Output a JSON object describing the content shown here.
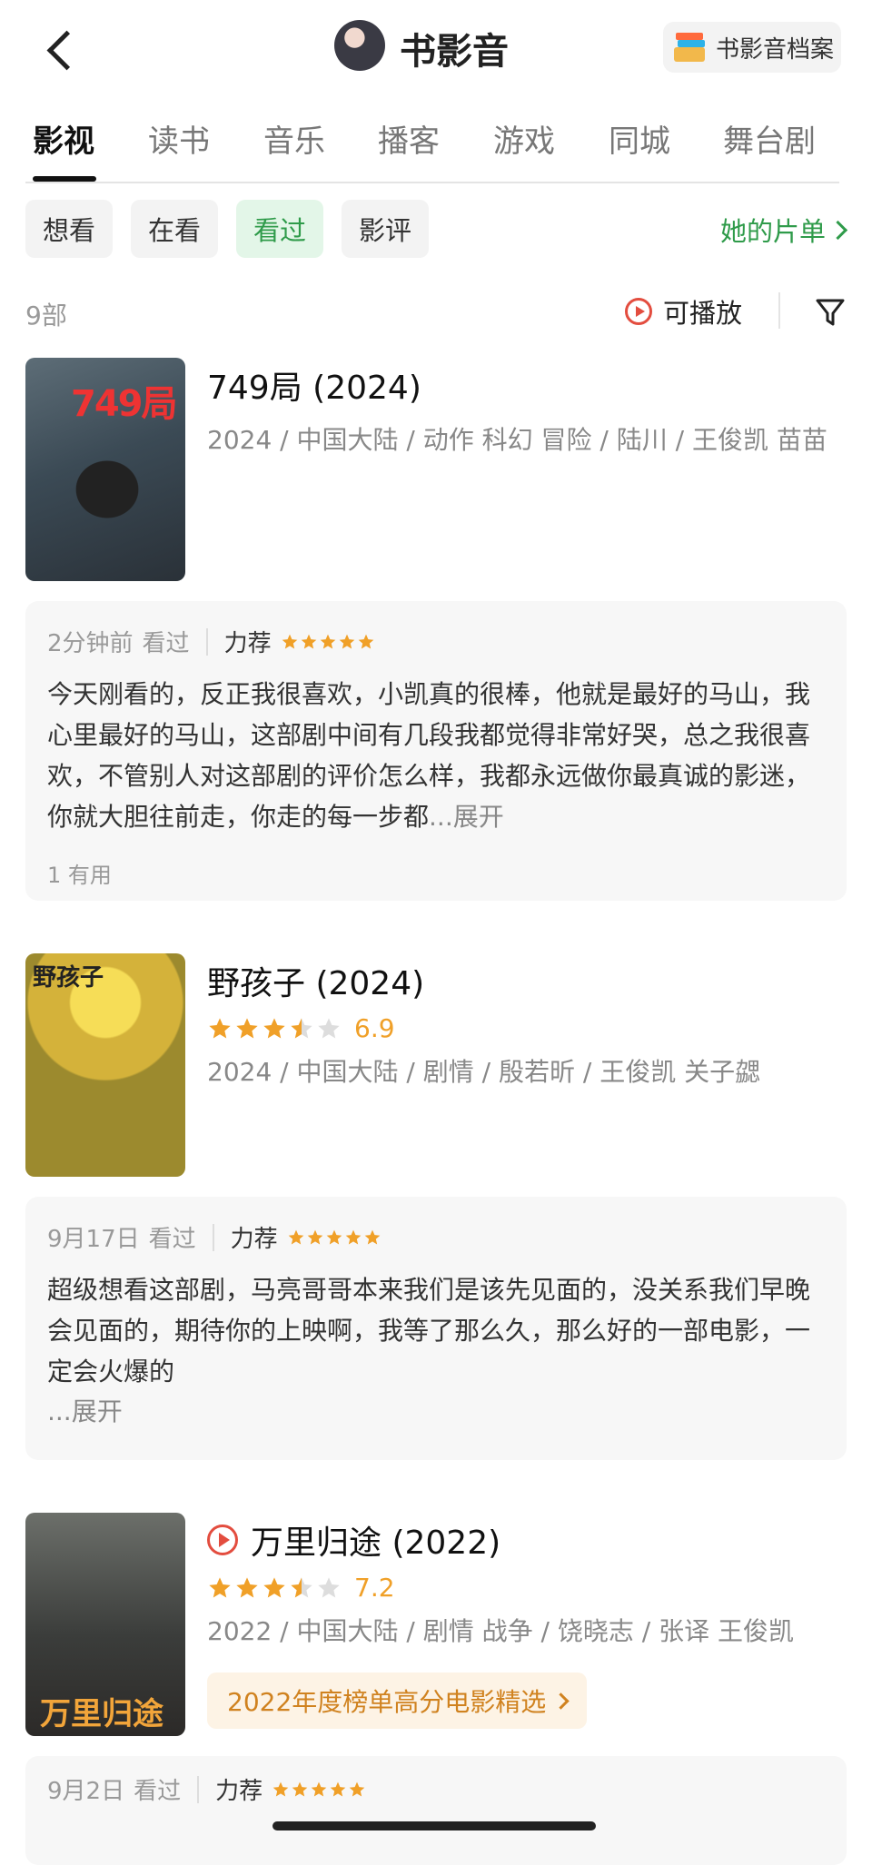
{
  "header": {
    "title": "书影音",
    "archive_label": "书影音档案"
  },
  "tabs": [
    {
      "label": "影视",
      "active": true
    },
    {
      "label": "读书",
      "active": false
    },
    {
      "label": "音乐",
      "active": false
    },
    {
      "label": "播客",
      "active": false
    },
    {
      "label": "游戏",
      "active": false
    },
    {
      "label": "同城",
      "active": false
    },
    {
      "label": "舞台剧",
      "active": false
    }
  ],
  "filters": {
    "chips": [
      {
        "label": "想看",
        "active": false
      },
      {
        "label": "在看",
        "active": false
      },
      {
        "label": "看过",
        "active": true
      },
      {
        "label": "影评",
        "active": false
      }
    ],
    "her_list": "她的片单"
  },
  "list": {
    "count": "9部",
    "playable": "可播放"
  },
  "colors": {
    "accent_green": "#2f9b4a",
    "star_orange": "#f0a028",
    "play_red": "#e34d3f"
  },
  "movies": [
    {
      "title": "749局 (2024)",
      "poster_text": "749局",
      "meta": "2024 / 中国大陆 / 动作 科幻 冒险 / 陆川 / 王俊凯 苗苗",
      "review": {
        "time": "2分钟前",
        "status": "看过",
        "recommend": "力荐",
        "my_stars": 5,
        "text": "今天刚看的，反正我很喜欢，小凯真的很棒，他就是最好的马山，我心里最好的马山，这部剧中间有几段我都觉得非常好哭，总之我很喜欢，不管别人对这部剧的评价怎么样，我都永远做你最真诚的影迷，你就大胆往前走，你走的每一步都",
        "expand": "...展开",
        "useful": "1 有用"
      }
    },
    {
      "title": "野孩子 (2024)",
      "poster_text": "野孩子",
      "rating_stars": 3.5,
      "score": "6.9",
      "meta": "2024 / 中国大陆 / 剧情 / 殷若昕 / 王俊凯 关子勰",
      "review": {
        "time": "9月17日",
        "status": "看过",
        "recommend": "力荐",
        "my_stars": 5,
        "text": "超级想看这部剧，马亮哥哥本来我们是该先见面的，没关系我们早晚会见面的，期待你的上映啊，我等了那么久，那么好的一部电影，一定会火爆的",
        "expand": "...展开"
      }
    },
    {
      "title": "万里归途 (2022)",
      "poster_text": "万里归途",
      "rating_stars": 3.5,
      "score": "7.2",
      "meta": "2022 / 中国大陆 / 剧情 战争 / 饶晓志 / 张译 王俊凯",
      "ranking_link": "2022年度榜单高分电影精选",
      "review": {
        "time": "9月2日",
        "status": "看过",
        "recommend": "力荐",
        "my_stars": 5
      }
    }
  ]
}
